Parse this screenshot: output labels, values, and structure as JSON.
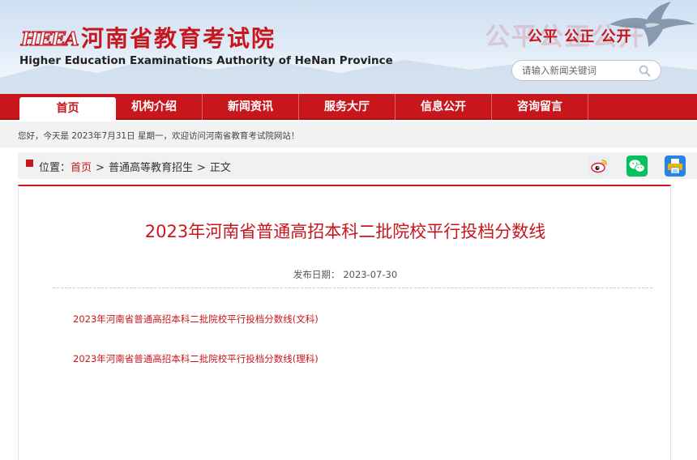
{
  "header": {
    "logo_mark": "HEEA",
    "logo_cn": "河南省教育考试院",
    "logo_en": "Higher Education Examinations Authority of HeNan Province",
    "slogan_bg": "公平公正公开",
    "slogan": "公平 公正 公开",
    "search": {
      "placeholder": "请输入新闻关键词"
    }
  },
  "nav": {
    "items": [
      {
        "label": "首页"
      },
      {
        "label": "机构介绍"
      },
      {
        "label": "新闻资讯"
      },
      {
        "label": "服务大厅"
      },
      {
        "label": "信息公开"
      },
      {
        "label": "咨询留言"
      }
    ]
  },
  "welcome": {
    "text": "您好，今天是 2023年7月31日 星期一，欢迎访问河南省教育考试院网站！"
  },
  "breadcrumb": {
    "prefix": "位置：",
    "home": "首页",
    "sep": ">",
    "section": "普通高等教育招生",
    "current": "正文"
  },
  "article": {
    "title": "2023年河南省普通高招本科二批院校平行投档分数线",
    "date_label": "发布日期：",
    "date": "2023-07-30",
    "attachments": [
      {
        "label": "2023年河南省普通高招本科二批院校平行投档分数线(文科)"
      },
      {
        "label": "2023年河南省普通高招本科二批院校平行投档分数线(理科)"
      }
    ]
  },
  "colors": {
    "brand_red": "#c8161d",
    "weibo": "#e6162d",
    "wechat": "#07c160",
    "print": "#2a82e4"
  },
  "icons": {
    "share": [
      "weibo-icon",
      "wechat-icon",
      "print-icon"
    ],
    "search": "search-icon"
  }
}
